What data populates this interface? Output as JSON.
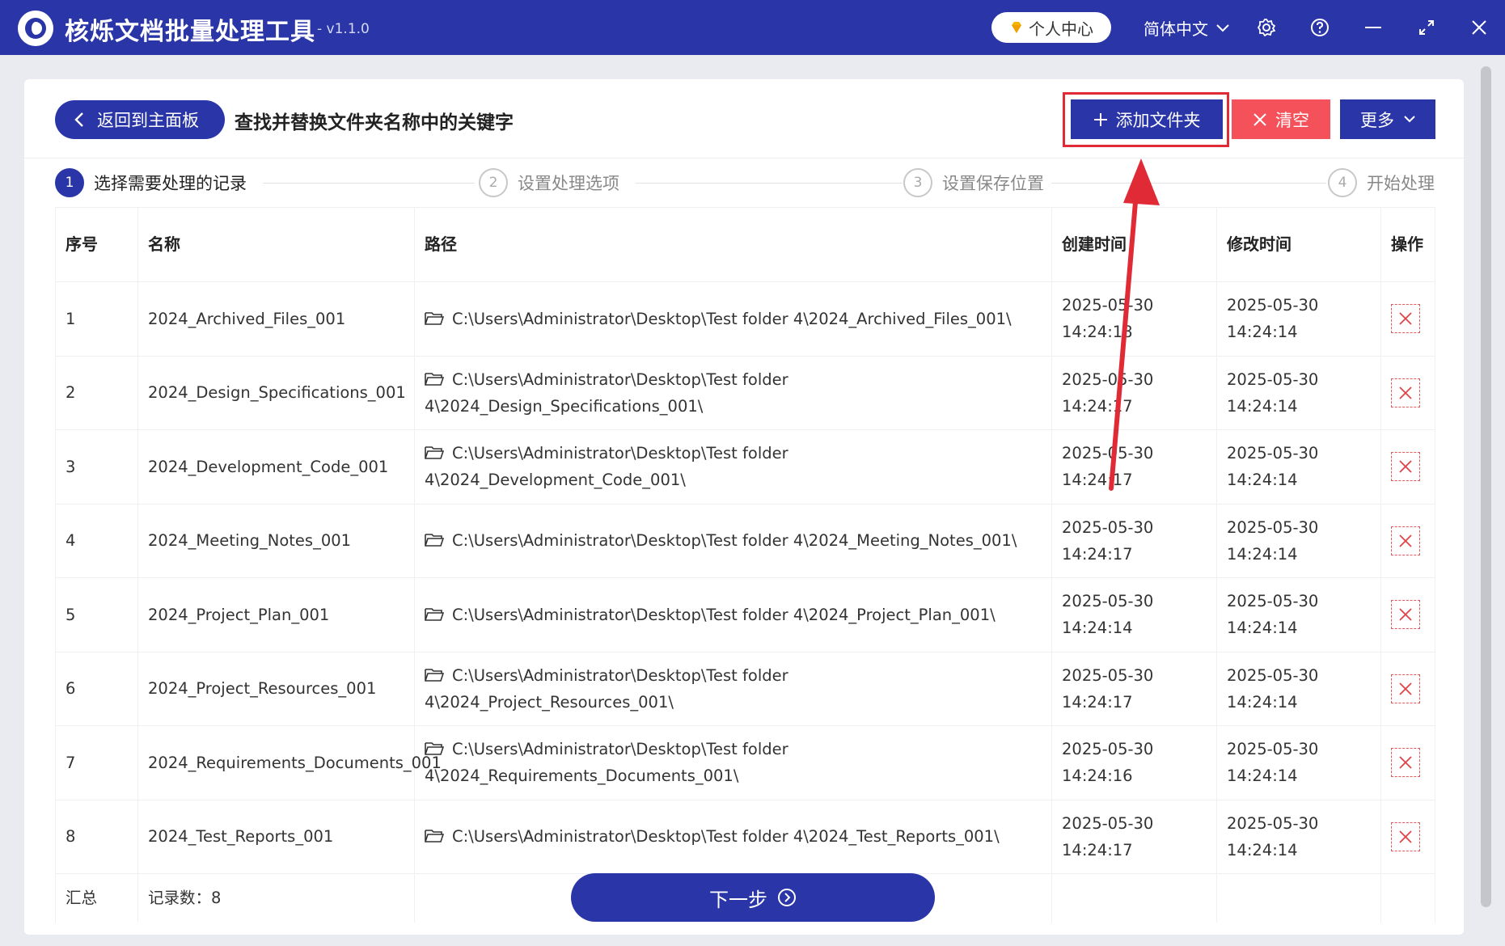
{
  "titlebar": {
    "app_title": "核烁文档批量处理工具",
    "version": "- v1.1.0",
    "user_center": "个人中心",
    "language": "简体中文",
    "icons": [
      "settings-icon",
      "help-icon",
      "minimize-icon",
      "maximize-icon",
      "close-icon"
    ]
  },
  "toolbar": {
    "back_label": "返回到主面板",
    "page_title": "查找并替换文件夹名称中的关键字",
    "add_folder_label": "添加文件夹",
    "clear_label": "清空",
    "more_label": "更多"
  },
  "steps": [
    {
      "num": "1",
      "label": "选择需要处理的记录"
    },
    {
      "num": "2",
      "label": "设置处理选项"
    },
    {
      "num": "3",
      "label": "设置保存位置"
    },
    {
      "num": "4",
      "label": "开始处理"
    }
  ],
  "table": {
    "headers": {
      "index": "序号",
      "name": "名称",
      "path": "路径",
      "created": "创建时间",
      "modified": "修改时间",
      "action": "操作"
    },
    "rows": [
      {
        "index": "1",
        "name": "2024_Archived_Files_001",
        "path": "C:\\Users\\Administrator\\Desktop\\Test folder 4\\2024_Archived_Files_001\\",
        "created": "2025-05-30 14:24:18",
        "modified": "2025-05-30 14:24:14"
      },
      {
        "index": "2",
        "name": "2024_Design_Specifications_001",
        "path": "C:\\Users\\Administrator\\Desktop\\Test folder 4\\2024_Design_Specifications_001\\",
        "created": "2025-05-30 14:24:17",
        "modified": "2025-05-30 14:24:14"
      },
      {
        "index": "3",
        "name": "2024_Development_Code_001",
        "path": "C:\\Users\\Administrator\\Desktop\\Test folder 4\\2024_Development_Code_001\\",
        "created": "2025-05-30 14:24:17",
        "modified": "2025-05-30 14:24:14"
      },
      {
        "index": "4",
        "name": "2024_Meeting_Notes_001",
        "path": "C:\\Users\\Administrator\\Desktop\\Test folder 4\\2024_Meeting_Notes_001\\",
        "created": "2025-05-30 14:24:17",
        "modified": "2025-05-30 14:24:14"
      },
      {
        "index": "5",
        "name": "2024_Project_Plan_001",
        "path": "C:\\Users\\Administrator\\Desktop\\Test folder 4\\2024_Project_Plan_001\\",
        "created": "2025-05-30 14:24:14",
        "modified": "2025-05-30 14:24:14"
      },
      {
        "index": "6",
        "name": "2024_Project_Resources_001",
        "path": "C:\\Users\\Administrator\\Desktop\\Test folder 4\\2024_Project_Resources_001\\",
        "created": "2025-05-30 14:24:17",
        "modified": "2025-05-30 14:24:14"
      },
      {
        "index": "7",
        "name": "2024_Requirements_Documents_001",
        "path": "C:\\Users\\Administrator\\Desktop\\Test folder 4\\2024_Requirements_Documents_001\\",
        "created": "2025-05-30 14:24:16",
        "modified": "2025-05-30 14:24:14"
      },
      {
        "index": "8",
        "name": "2024_Test_Reports_001",
        "path": "C:\\Users\\Administrator\\Desktop\\Test folder 4\\2024_Test_Reports_001\\",
        "created": "2025-05-30 14:24:17",
        "modified": "2025-05-30 14:24:14"
      }
    ],
    "footer": {
      "total_label": "汇总",
      "record_count": "记录数：8"
    }
  },
  "next_label": "下一步",
  "colors": {
    "primary": "#2a36a8",
    "danger": "#f5515b",
    "highlight": "#e02a35"
  }
}
